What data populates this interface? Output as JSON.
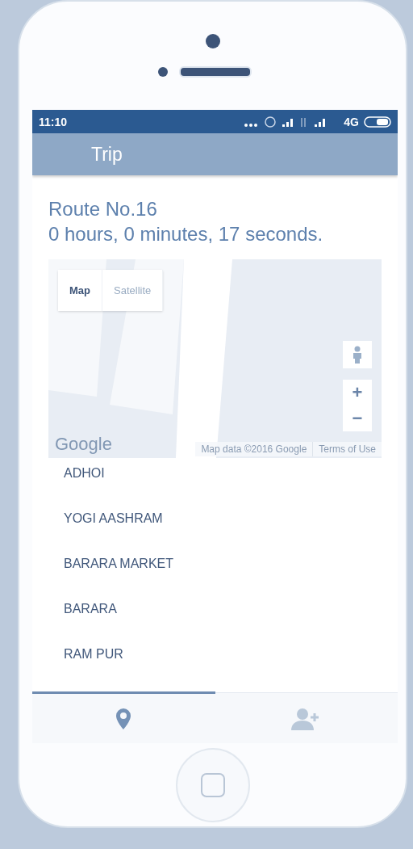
{
  "status_bar": {
    "time": "11:10",
    "network": "4G"
  },
  "app_bar": {
    "title": "Trip"
  },
  "route": {
    "name": "Route No.16",
    "duration": "0 hours, 0 minutes, 17 seconds."
  },
  "map": {
    "types": [
      {
        "label": "Map",
        "selected": true
      },
      {
        "label": "Satellite",
        "selected": false
      }
    ],
    "zoom_in": "+",
    "zoom_out": "−",
    "logo": "Google",
    "attribution": "Map data ©2016 Google",
    "terms": "Terms of Use"
  },
  "stops": [
    "ADHOI",
    "YOGI AASHRAM",
    "BARARA MARKET",
    "BARARA",
    "RAM PUR"
  ],
  "bottom_nav": [
    {
      "kind": "pin",
      "selected": true
    },
    {
      "kind": "add-user",
      "selected": false
    }
  ]
}
